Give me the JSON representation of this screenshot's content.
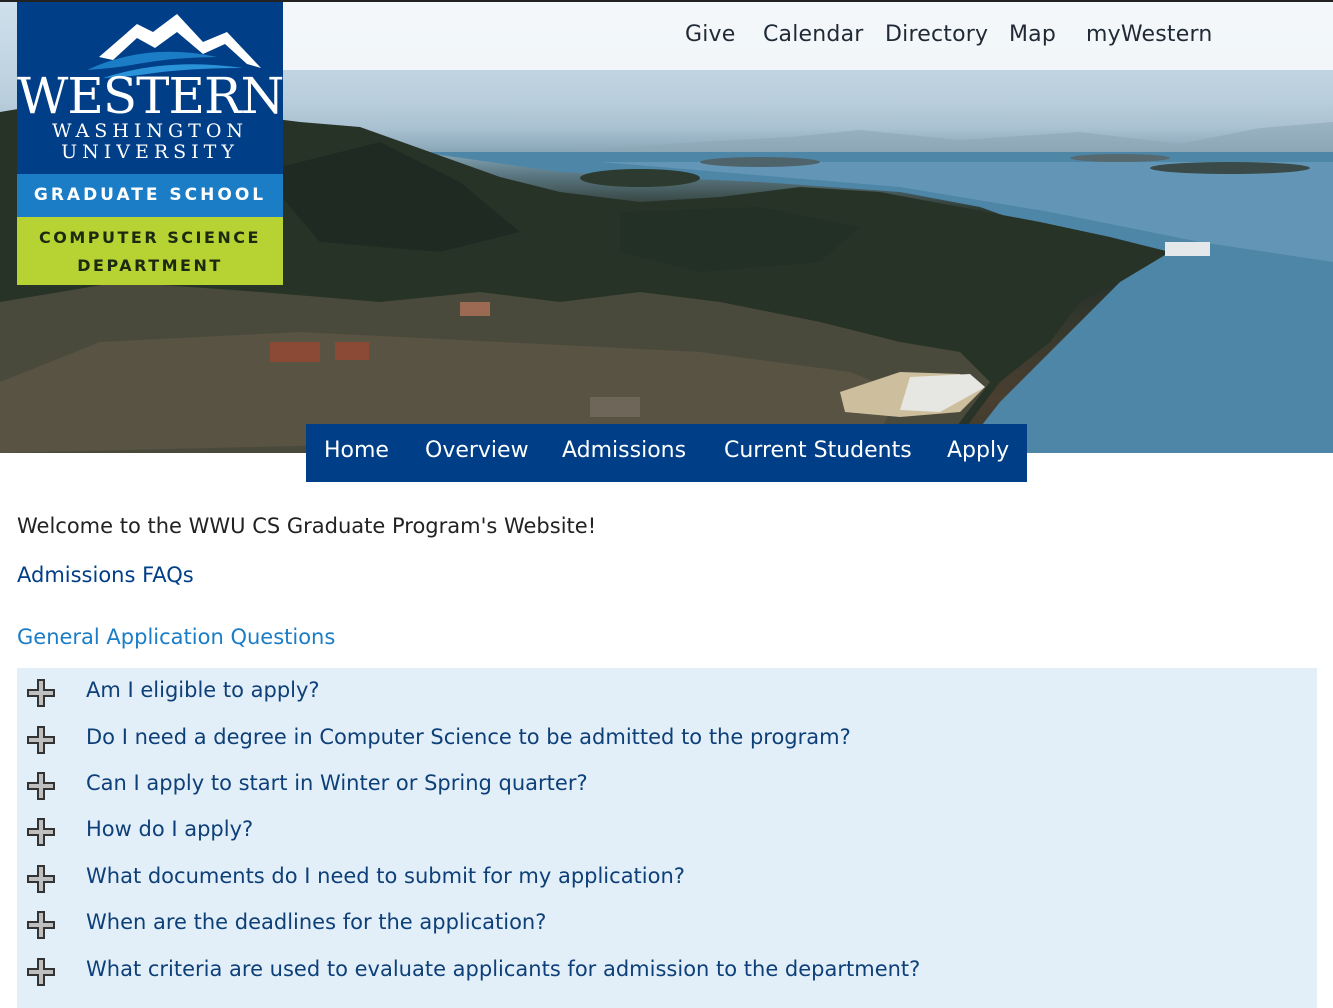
{
  "utility_nav": [
    "Give",
    "Calendar",
    "Directory",
    "Map",
    "myWestern"
  ],
  "logo": {
    "icon": "mountain-waves-icon",
    "word1": "WESTERN",
    "word2": "WASHINGTON",
    "word3": "UNIVERSITY",
    "unit": "GRADUATE SCHOOL",
    "dept_line1": "COMPUTER SCIENCE",
    "dept_line2": "DEPARTMENT"
  },
  "main_nav": [
    "Home",
    "Overview",
    "Admissions",
    "Current Students",
    "Apply"
  ],
  "content": {
    "welcome": "Welcome to the WWU CS Graduate Program's Website!",
    "faq_title": "Admissions FAQs",
    "section_title": "General Application Questions"
  },
  "faq_items": [
    "Am I eligible to apply?",
    "Do I need a degree in Computer Science to be admitted to the program?",
    "Can I apply to start in Winter or Spring quarter?",
    "How do I apply?",
    "What documents do I need to submit for my application?",
    "When are the deadlines for the application?",
    "What criteria are used to evaluate applicants for admission to the department?"
  ],
  "colors": {
    "brand_blue": "#003f87",
    "accent_blue": "#1b7dc6",
    "lime": "#b7d233",
    "accordion_bg": "#e3eff8"
  }
}
